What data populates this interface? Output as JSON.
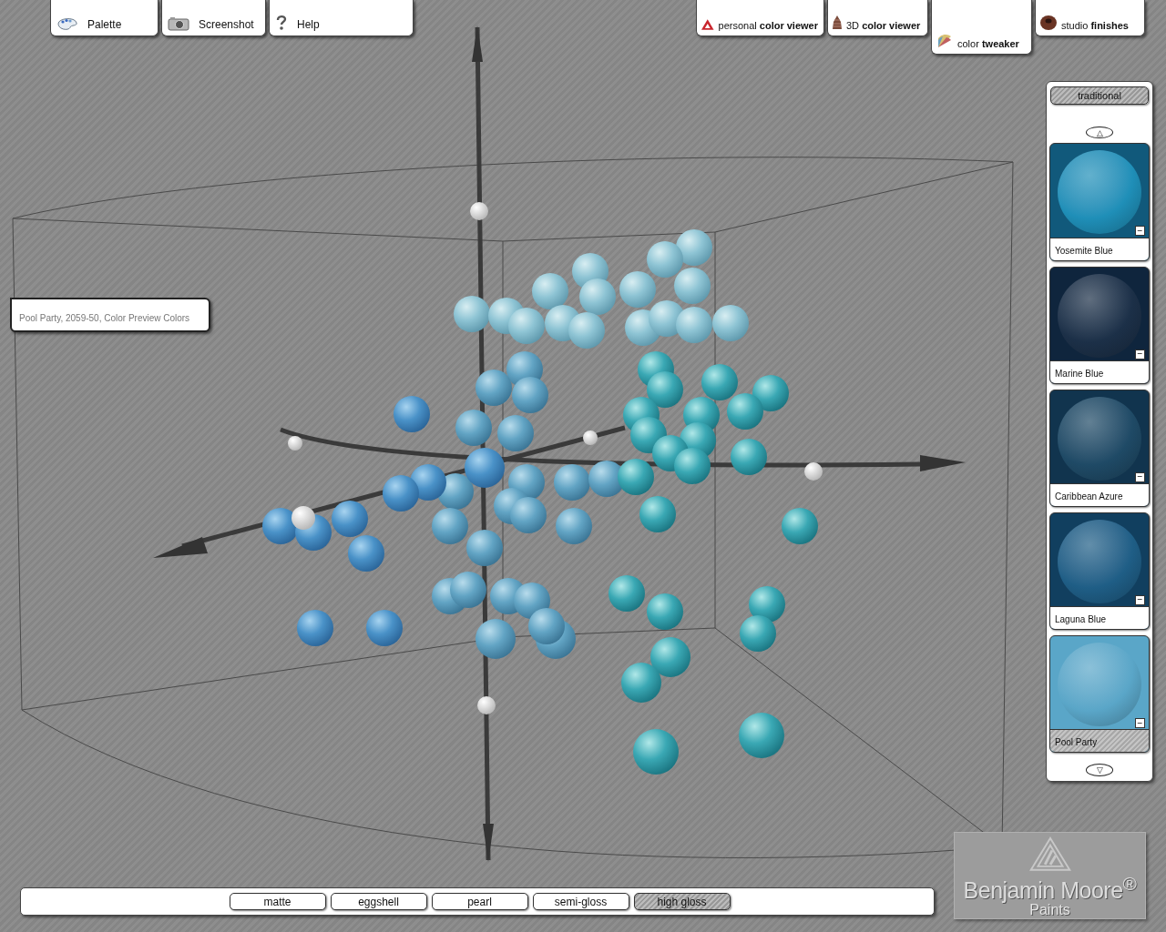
{
  "toolbar": [
    {
      "label": "Palette"
    },
    {
      "label": "Screenshot"
    },
    {
      "label": "Help"
    }
  ],
  "view_tabs": [
    {
      "label": "personal **color viewer**",
      "selected": false
    },
    {
      "label": "3D **color viewer**",
      "selected": false
    },
    {
      "label": "color **tweaker**",
      "selected": true
    },
    {
      "label": "studio **finishes**",
      "selected": false
    }
  ],
  "info_label": "Pool Party, 2059-50, Color Preview Colors",
  "sidebar": {
    "collection": "traditional",
    "scroll_up": "△",
    "scroll_down": "▽",
    "remove": "−",
    "swatches": [
      {
        "name": "Yosemite Blue",
        "color": "#1f8fb8",
        "selected": false
      },
      {
        "name": "Marine Blue",
        "color": "#1c3048",
        "selected": false
      },
      {
        "name": "Caribbean Azure",
        "color": "#1f4a66",
        "selected": false
      },
      {
        "name": "Laguna Blue",
        "color": "#1f5e86",
        "selected": false
      },
      {
        "name": "Pool Party",
        "color": "#5aa6c8",
        "selected": true
      }
    ]
  },
  "finishes": [
    {
      "label": "matte",
      "selected": false
    },
    {
      "label": "eggshell",
      "selected": false
    },
    {
      "label": "pearl",
      "selected": false
    },
    {
      "label": "semi-gloss",
      "selected": false
    },
    {
      "label": "high gloss",
      "selected": true
    }
  ],
  "logo": {
    "name": "Benjamin Moore$^{®}$",
    "tagline": "Paints"
  }
}
